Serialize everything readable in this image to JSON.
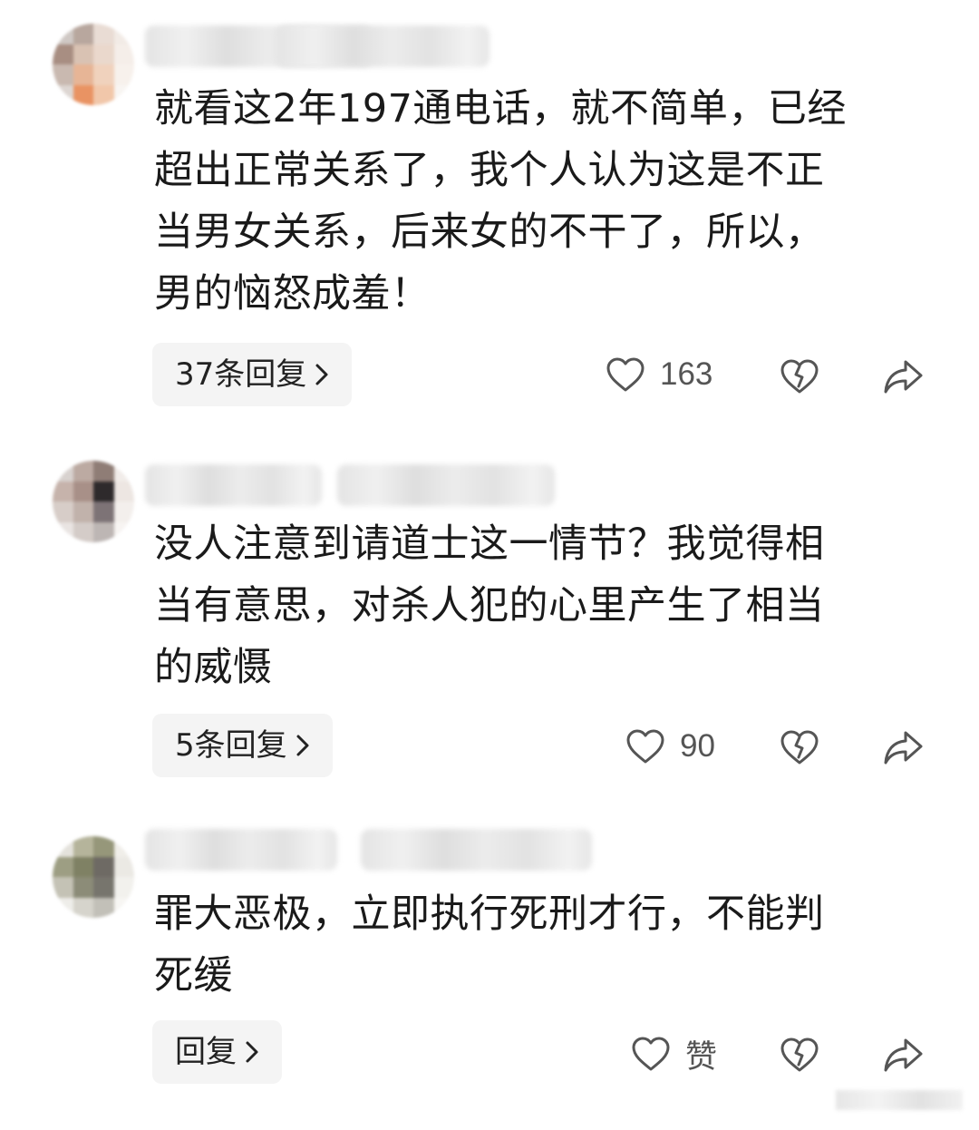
{
  "comments": [
    {
      "text_lines": [
        "就看这2年197通电话，就不简单，已经",
        "超出正常关系了，我个人认为这是不正",
        "当男女关系，后来女的不干了，所以，",
        "男的恼怒成羞！"
      ],
      "reply_label": "37条回复",
      "like_label": "163",
      "avatar_colors": [
        "#cfc8c4",
        "#b8a79e",
        "#e9dcd4",
        "#f2ebe6",
        "#a88e82",
        "#d9c2b3",
        "#ead8cc",
        "#f5eee9",
        "#c9b9b0",
        "#e7b596",
        "#f0d2bd",
        "#f7f1ec",
        "#ddd6d2",
        "#e99363",
        "#f1c7aa",
        "#f8f5f2"
      ]
    },
    {
      "text_lines": [
        "没人注意到请道士这一情节？我觉得相",
        "当有意思，对杀人犯的心里产生了相当",
        "的威慑"
      ],
      "reply_label": "5条回复",
      "like_label": "90",
      "avatar_colors": [
        "#d8d2cf",
        "#bcaaa2",
        "#8f7d76",
        "#f1ece9",
        "#c6b3ab",
        "#a89088",
        "#2e2a2c",
        "#ede6e2",
        "#d7cdc8",
        "#c1b2ab",
        "#7d7376",
        "#f3efec",
        "#e9e4e2",
        "#d4ccc8",
        "#bdb6b4",
        "#f7f4f2"
      ]
    },
    {
      "text_lines": [
        "罪大恶极，立即执行死刑才行，不能判",
        "死缓"
      ],
      "reply_label": "回复",
      "like_label": "赞",
      "avatar_colors": [
        "#e4e2dc",
        "#b5b49b",
        "#96977a",
        "#f0eee9",
        "#9d9e83",
        "#7f8164",
        "#6e6a64",
        "#ebe9e4",
        "#c4c2b5",
        "#8c8c78",
        "#77756d",
        "#f2f1ed",
        "#eeede9",
        "#d6d4cc",
        "#c2c0b8",
        "#f7f6f3"
      ]
    }
  ],
  "icons": {
    "like": "heart-outline-icon",
    "dislike": "broken-heart-icon",
    "share": "share-arrow-icon",
    "chevron": "chevron-right-icon"
  },
  "colors": {
    "text": "#1a1a1a",
    "icon": "#555555",
    "reply_bg": "#f4f4f4"
  }
}
